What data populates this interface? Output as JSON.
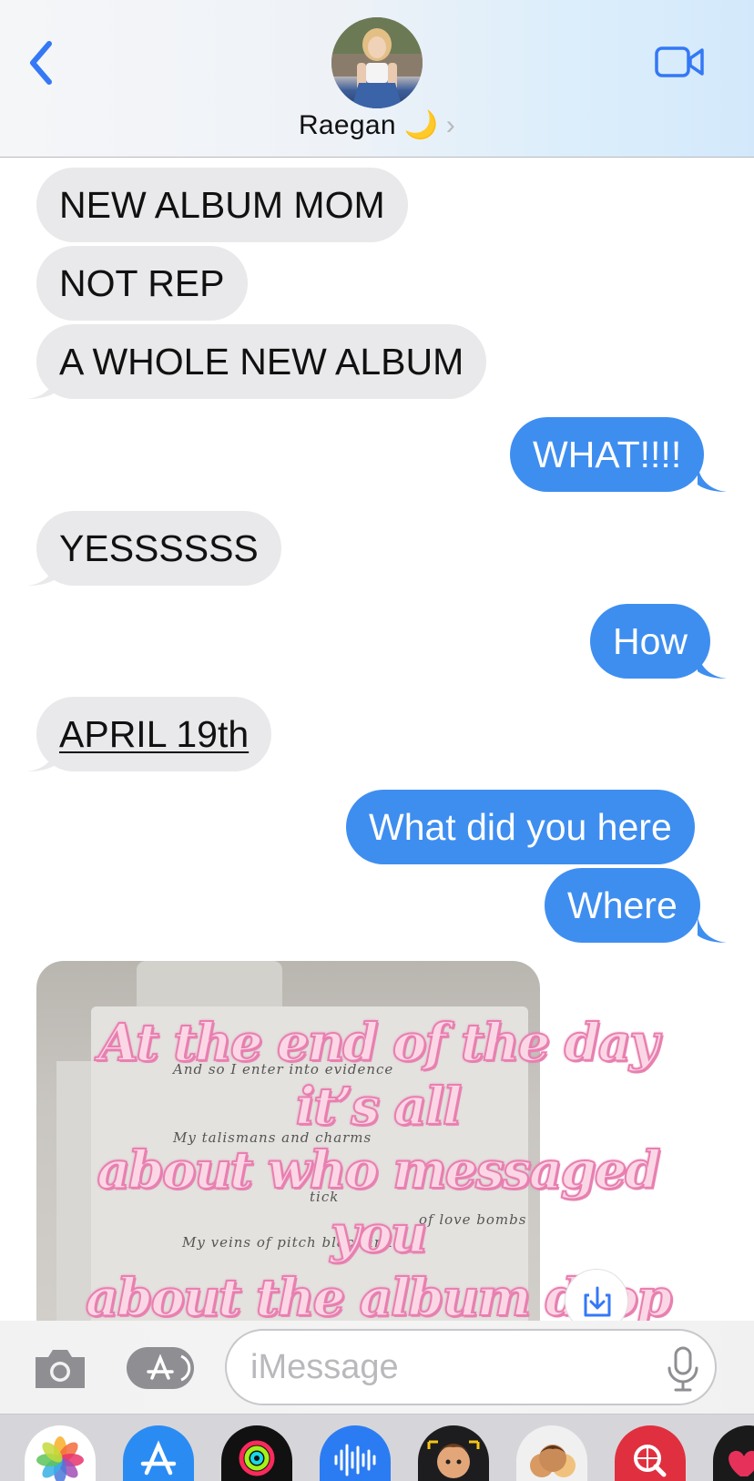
{
  "header": {
    "contact_name": "Raegan 🌙",
    "chevron": "›",
    "back_icon": "chevron-left-icon",
    "video_icon": "video-camera-icon",
    "accent_color": "#3478f6"
  },
  "messages": [
    {
      "side": "incoming",
      "text": "NEW ALBUM MOM"
    },
    {
      "side": "incoming",
      "text": "NOT REP"
    },
    {
      "side": "incoming",
      "text": "A WHOLE NEW ALBUM"
    },
    {
      "side": "outgoing",
      "text": "WHAT!!!!"
    },
    {
      "side": "incoming",
      "text": "YESSSSSS"
    },
    {
      "side": "outgoing",
      "text": "How"
    },
    {
      "side": "incoming",
      "text": "APRIL 19th",
      "underlined": true
    },
    {
      "side": "outgoing",
      "text": "What did you here"
    },
    {
      "side": "outgoing",
      "text": "Where"
    }
  ],
  "image_message": {
    "handwriting": [
      "And so I enter into evidence",
      "My talismans and charms",
      "tick",
      "of love bombs",
      "My veins of pitch black ink"
    ],
    "overlay_lines": [
      "At the end of the day it’s all",
      "about who messaged you",
      "about the album drop"
    ],
    "overlay_emoji": "💕",
    "save_icon": "download-to-photos-icon"
  },
  "compose": {
    "placeholder": "iMessage",
    "camera_icon": "camera-icon",
    "apps_icon": "app-store-icon",
    "mic_icon": "microphone-icon"
  },
  "app_drawer": [
    {
      "name": "photos-app-icon"
    },
    {
      "name": "app-store-app-icon"
    },
    {
      "name": "activity-app-icon"
    },
    {
      "name": "audio-message-app-icon"
    },
    {
      "name": "memoji-app-icon"
    },
    {
      "name": "memoji-stickers-app-icon"
    },
    {
      "name": "image-search-app-icon"
    },
    {
      "name": "heart-app-icon"
    }
  ],
  "colors": {
    "incoming_bubble": "#e9e9eb",
    "outgoing_bubble": "#3e8ef0",
    "overlay_fill": "#fbd7e6",
    "overlay_stroke": "#e97fb0"
  }
}
